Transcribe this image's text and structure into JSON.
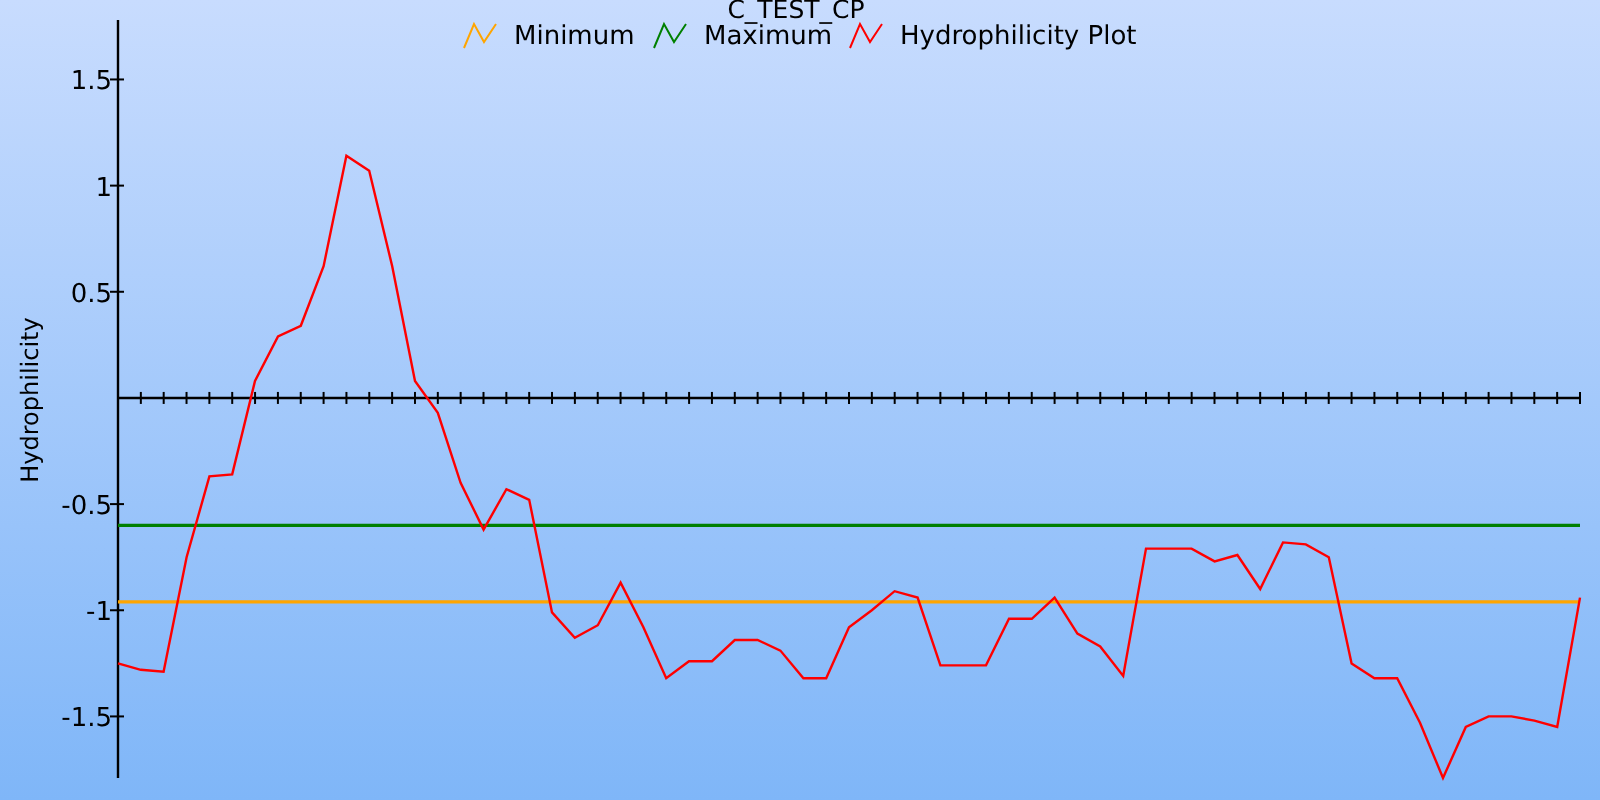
{
  "chart": {
    "chart_data": {
      "type": "line",
      "title": "C_TEST_CP",
      "legend": true,
      "ylabel": "Hydrophilicity",
      "ylim": [
        -1.79,
        1.78
      ],
      "yticks": [
        -1.5,
        -1,
        -0.5,
        0.5,
        1,
        1.5
      ],
      "series": [
        {
          "name": "Minimum",
          "color": "#ffa500",
          "values": [
            -0.96,
            -0.96,
            -0.96,
            -0.96,
            -0.96,
            -0.96,
            -0.96,
            -0.96,
            -0.96,
            -0.96,
            -0.96,
            -0.96,
            -0.96,
            -0.96,
            -0.96,
            -0.96,
            -0.96,
            -0.96,
            -0.96,
            -0.96,
            -0.96,
            -0.96,
            -0.96,
            -0.96,
            -0.96,
            -0.96,
            -0.96,
            -0.96,
            -0.96,
            -0.96,
            -0.96,
            -0.96,
            -0.96,
            -0.96,
            -0.96,
            -0.96,
            -0.96,
            -0.96,
            -0.96,
            -0.96,
            -0.96,
            -0.96,
            -0.96,
            -0.96,
            -0.96,
            -0.96,
            -0.96,
            -0.96,
            -0.96,
            -0.96,
            -0.96,
            -0.96,
            -0.96,
            -0.96,
            -0.96,
            -0.96,
            -0.96,
            -0.96,
            -0.96,
            -0.96,
            -0.96,
            -0.96,
            -0.96,
            -0.96,
            -0.96
          ]
        },
        {
          "name": "Maximum",
          "color": "#008000",
          "values": [
            -0.6,
            -0.6,
            -0.6,
            -0.6,
            -0.6,
            -0.6,
            -0.6,
            -0.6,
            -0.6,
            -0.6,
            -0.6,
            -0.6,
            -0.6,
            -0.6,
            -0.6,
            -0.6,
            -0.6,
            -0.6,
            -0.6,
            -0.6,
            -0.6,
            -0.6,
            -0.6,
            -0.6,
            -0.6,
            -0.6,
            -0.6,
            -0.6,
            -0.6,
            -0.6,
            -0.6,
            -0.6,
            -0.6,
            -0.6,
            -0.6,
            -0.6,
            -0.6,
            -0.6,
            -0.6,
            -0.6,
            -0.6,
            -0.6,
            -0.6,
            -0.6,
            -0.6,
            -0.6,
            -0.6,
            -0.6,
            -0.6,
            -0.6,
            -0.6,
            -0.6,
            -0.6,
            -0.6,
            -0.6,
            -0.6,
            -0.6,
            -0.6,
            -0.6,
            -0.6,
            -0.6,
            -0.6,
            -0.6,
            -0.6,
            -0.6
          ]
        },
        {
          "name": "Hydrophilicity Plot",
          "color": "#ff0000",
          "values": [
            -1.25,
            -1.28,
            -1.29,
            -0.75,
            -0.37,
            -0.36,
            0.08,
            0.29,
            0.34,
            0.62,
            1.14,
            1.07,
            0.62,
            0.08,
            -0.07,
            -0.4,
            -0.62,
            -0.43,
            -0.48,
            -1.01,
            -1.13,
            -1.07,
            -0.87,
            -1.08,
            -1.32,
            -1.24,
            -1.24,
            -1.14,
            -1.14,
            -1.19,
            -1.32,
            -1.32,
            -1.08,
            -1.0,
            -0.91,
            -0.94,
            -1.26,
            -1.26,
            -1.26,
            -1.04,
            -1.04,
            -0.94,
            -1.11,
            -1.17,
            -1.31,
            -0.71,
            -0.71,
            -0.71,
            -0.77,
            -0.74,
            -0.9,
            -0.68,
            -0.69,
            -0.75,
            -1.25,
            -1.32,
            -1.32,
            -1.53,
            -1.79,
            -1.55,
            -1.5,
            -1.5,
            -1.52,
            -1.55,
            -0.94
          ]
        }
      ]
    }
  }
}
